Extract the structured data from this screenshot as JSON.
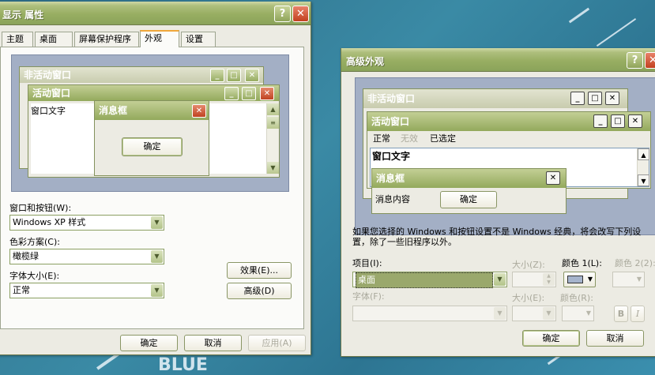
{
  "desktop": {
    "wordmark": "BLUE"
  },
  "display_props": {
    "title": "显示 属性",
    "tabs": [
      "主题",
      "桌面",
      "屏幕保护程序",
      "外观",
      "设置"
    ],
    "active_tab": "外观",
    "preview": {
      "inactive_title": "非活动窗口",
      "active_title": "活动窗口",
      "window_text": "窗口文字",
      "msgbox_title": "消息框",
      "ok_label": "确定"
    },
    "windows_buttons_label": "窗口和按钮(W):",
    "windows_buttons_value": "Windows XP 样式",
    "color_scheme_label": "色彩方案(C):",
    "color_scheme_value": "橄榄绿",
    "font_size_label": "字体大小(E):",
    "font_size_value": "正常",
    "effects_button": "效果(E)...",
    "advanced_button": "高级(D)",
    "ok_button": "确定",
    "cancel_button": "取消",
    "apply_button": "应用(A)"
  },
  "advanced": {
    "title": "高级外观",
    "preview": {
      "inactive_title": "非活动窗口",
      "active_title": "活动窗口",
      "menu_normal": "正常",
      "menu_disabled": "无效",
      "menu_selected": "已选定",
      "window_text": "窗口文字",
      "msgbox_title": "消息框",
      "msg_content": "消息内容",
      "ok_label": "确定"
    },
    "notice": "如果您选择的 Windows 和按钮设置不是 Windows 经典，将会改写下列设置，除了一些旧程序以外。",
    "item_label": "项目(I):",
    "item_value": "桌面",
    "size_label": "大小(Z):",
    "color1_label": "颜色 1(L):",
    "color2_label": "颜色 2(2):",
    "font_label": "字体(F):",
    "font_size_label": "大小(E):",
    "font_color_label": "颜色(R):",
    "bold_label": "B",
    "italic_label": "I",
    "ok_button": "确定",
    "cancel_button": "取消"
  },
  "colors": {
    "accent": "#98ae62",
    "desktop": "#2e6c86",
    "color1_swatch": "#a6b4cc",
    "item_selected": "#9aa86c"
  }
}
